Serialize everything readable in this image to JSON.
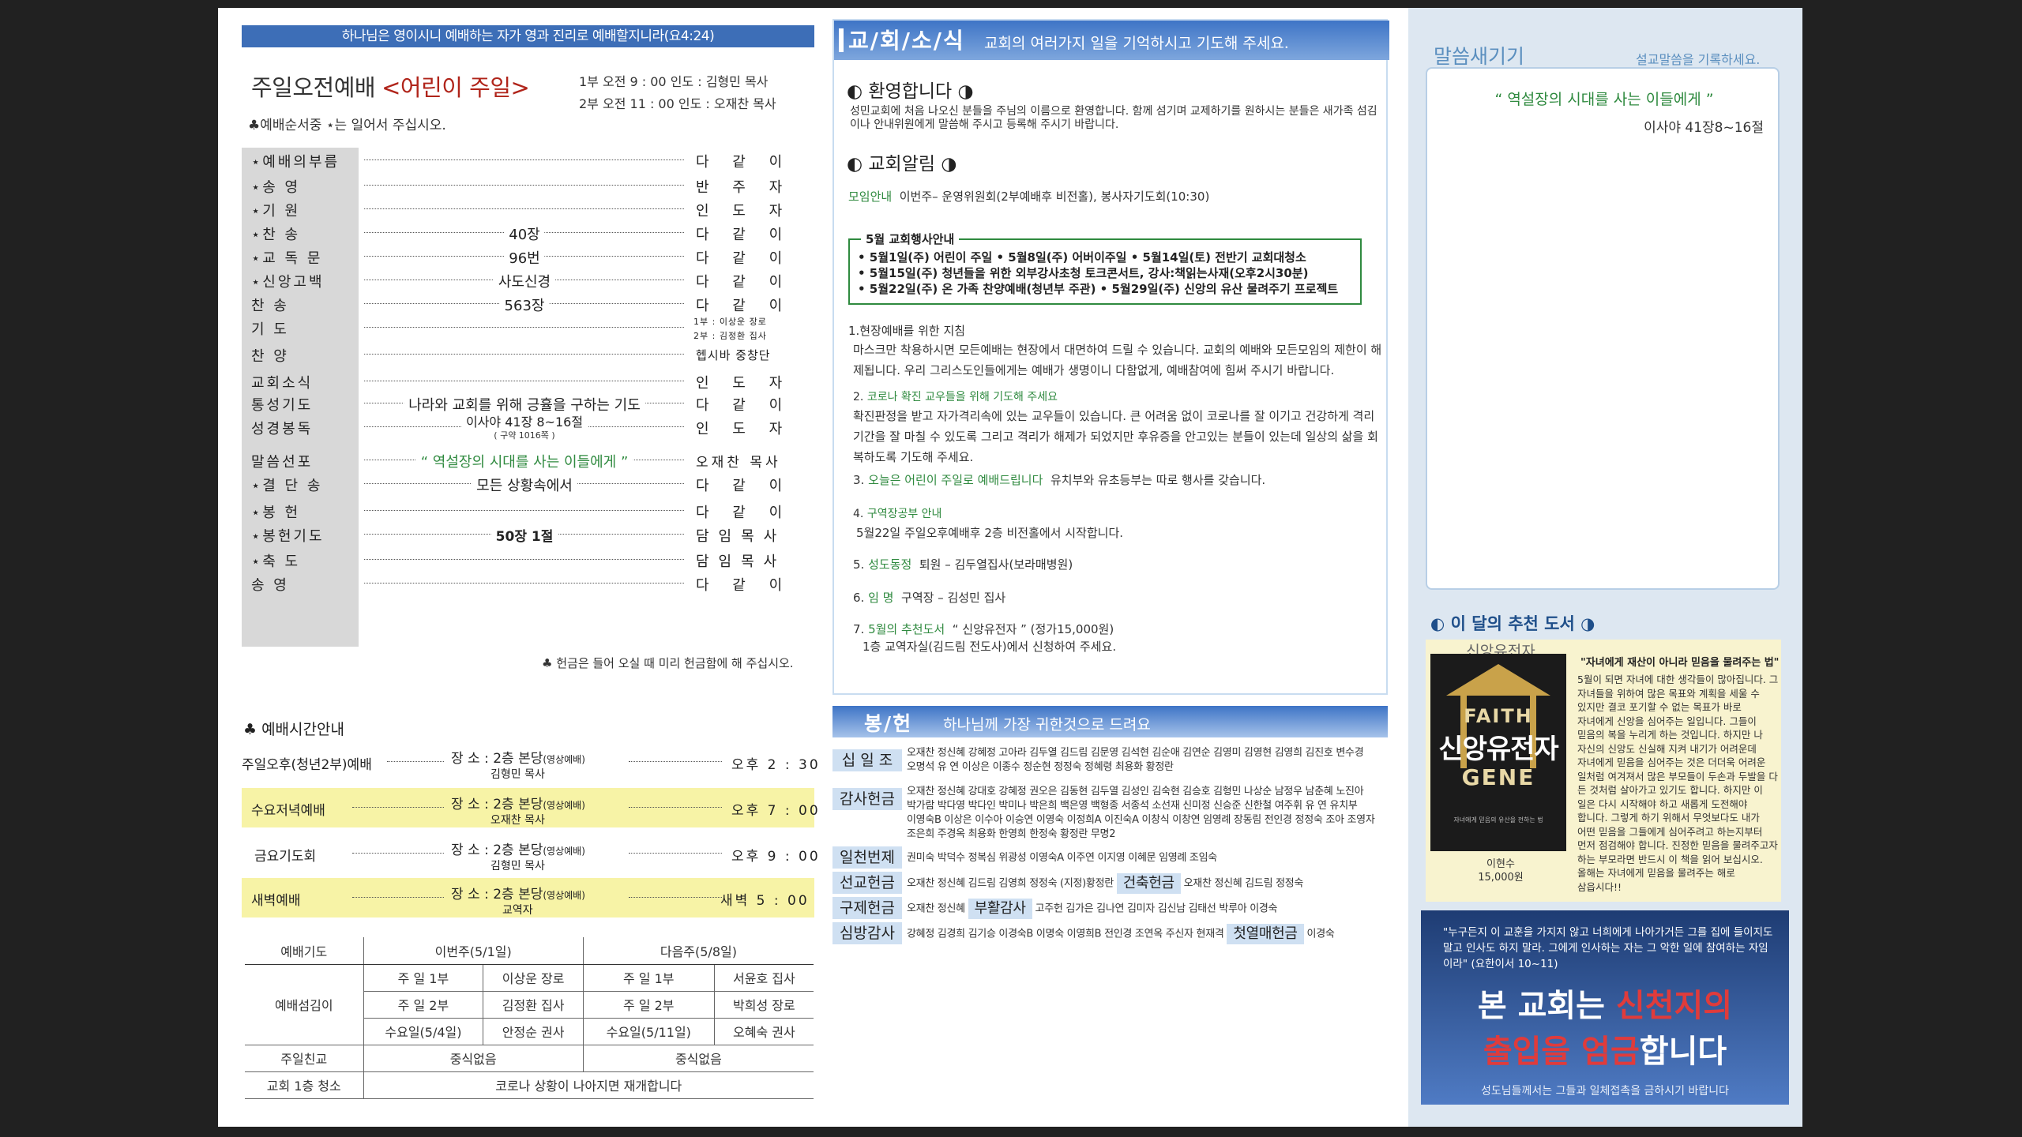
{
  "header_verse": "하나님은 영이시니 예배하는 자가 영과 진리로 예배할지니라(요4:24)",
  "service": {
    "title": "주일오전예배",
    "child": "<어린이 주일>",
    "time1": "1부 오전 9 : 00  인도 : 김형민 목사",
    "time2": "2부 오전 11 : 00  인도 : 오재찬 목사",
    "order_note": "♣예배순서중 ⋆는 일어서 주십시오."
  },
  "order": [
    {
      "label": "⋆예배의부름",
      "mid": "",
      "who": "다 같 이"
    },
    {
      "label": "⋆송    영",
      "mid": "",
      "who": "반 주 자"
    },
    {
      "label": "⋆기    원",
      "mid": "",
      "who": "인 도 자"
    },
    {
      "label": "⋆찬    송",
      "mid": "40장",
      "who": "다 같 이"
    },
    {
      "label": "⋆교 독 문",
      "mid": "96번",
      "who": "다 같 이"
    },
    {
      "label": "⋆신앙고백",
      "mid": "사도신경",
      "who": "다 같 이"
    },
    {
      "label": "찬    송",
      "mid": "563장",
      "who": "다 같 이"
    },
    {
      "label": "기    도",
      "mid": "",
      "who1": "1부 : 이상운 장로",
      "who2": "2부 : 김정환 집사"
    },
    {
      "label": "찬    양",
      "mid": "",
      "who": "헵시바 중창단"
    },
    {
      "label": "교회소식",
      "mid": "",
      "who": "인 도 자"
    },
    {
      "label": "통성기도",
      "mid": "나라와 교회를 위해 긍휼을 구하는 기도",
      "who": "다 같 이"
    },
    {
      "label": "성경봉독",
      "mid": "이사야 41장 8~16절",
      "sub": "( 구약 1016쪽 )",
      "who": "인 도 자"
    },
    {
      "label": "말씀선포",
      "mid": "“ 역설장의 시대를 사는 이들에게 ”",
      "who": "오재찬 목사"
    },
    {
      "label": "⋆결 단 송",
      "mid": "모든 상황속에서",
      "who": "다 같 이"
    },
    {
      "label": "⋆봉    헌",
      "mid": "",
      "who": "다 같 이"
    },
    {
      "label": "⋆봉헌기도",
      "mid": "50장 1절",
      "who": "담임목사"
    },
    {
      "label": "⋆축    도",
      "mid": "",
      "who": "담임목사"
    },
    {
      "label": "송    영",
      "mid": "",
      "who": "다 같 이"
    }
  ],
  "offering_note": "♣ 헌금은 들어 오실 때 미리 헌금함에 해 주십시오.",
  "times_head": "♣ 예배시간안내",
  "times": [
    {
      "name": "주일오후(청년2부)예배",
      "place": "장 소 : 2층 본당",
      "small": "(영상예배)",
      "pastor": "김형민 목사",
      "time": "오후 2 : 30"
    },
    {
      "name": "수요저녁예배",
      "place": "장 소 : 2층 본당",
      "small": "(영상예배)",
      "pastor": "오재찬 목사",
      "time": "오후 7 : 00"
    },
    {
      "name": "금요기도회",
      "place": "장 소 : 2층 본당",
      "small": "(영상예배)",
      "pastor": "김형민 목사",
      "time": "오후 9 : 00"
    },
    {
      "name": "새벽예배",
      "place": "장 소 : 2층 본당",
      "small": "(영상예배)",
      "pastor": "교역자",
      "time": "새벽 5 : 00"
    }
  ],
  "duty": {
    "head": [
      "예배기도",
      "이번주(5/1일)",
      "다음주(5/8일)"
    ],
    "label_serve": "예배섬김이",
    "rows": [
      [
        "주 일 1부",
        "이상운 장로",
        "주 일 1부",
        "서윤호 집사"
      ],
      [
        "주 일 2부",
        "김정환 집사",
        "주 일 2부",
        "박희성 장로"
      ],
      [
        "수요일(5/4일)",
        "안정순 권사",
        "수요일(5/11일)",
        "오혜숙 권사"
      ]
    ],
    "fellowship_label": "주일친교",
    "fellowship_this": "중식없음",
    "fellowship_next": "중식없음",
    "clean_label": "교회 1층 청소",
    "clean_value": "코로나 상황이 나아지면 재개합니다"
  },
  "news": {
    "head_big": "교/회/소/식",
    "head_small": "교회의 여러가지 일을 기억하시고 기도해 주세요.",
    "welcome_title": "◐ 환영합니다 ◑",
    "welcome_text": "성민교회에 처음 나오신 분들을 주님의 이름으로 환영합니다. 함께 섬기며 교제하기를 원하시는 분들은 새가족 섬김이나 안내위원에게 말씀해 주시고 등록해 주시기 바랍니다.",
    "notice_title": "◐ 교회알림 ◑",
    "meet_head": "모임안내",
    "meet_text": "이번주– 운영위원회(2부예배후 비전홀), 봉사자기도회(10:30)",
    "event_title": "5월 교회행사안내",
    "event_lines": [
      "• 5월1일(주) 어린이 주일  • 5월8일(주) 어버이주일   • 5월14일(토) 전반기 교회대청소",
      "• 5월15일(주) 청년들을 위한 외부강사초청 토크콘서트, 강사:책읽는사재(오후2시30분)",
      "• 5월22일(주) 온 가족 찬양예배(청년부 주관)   • 5월29일(주) 신앙의 유산 물려주기 프로젝트"
    ],
    "n1_head": "1.현장예배를 위한 지침",
    "n1_text": "마스크만 착용하시면 모든예배는 현장에서 대면하여 드릴 수 있습니다. 교회의 예배와 모든모임의 제한이 해제됩니다. 우리 그리스도인들에게는 예배가 생명이니 다함없게, 예배참여에 힘써 주시기 바랍니다.",
    "n2_num": "2.",
    "n2_head": "코로나 확진 교우들을 위해 기도해 주세요",
    "n2_text": "확진판정을 받고 자가격리속에 있는 교우들이 있습니다. 큰 어려움 없이 코로나를 잘 이기고 건강하게 격리기간을 잘 마칠 수 있도록  그리고 격리가 해제가 되었지만 후유증을 안고있는 분들이 있는데 일상의 삶을 회복하도록 기도해 주세요.",
    "n3_num": "3.",
    "n3_head": "오늘은 어린이 주일로 예배드립니다",
    "n3_text": "유치부와 유초등부는 따로 행사를 갖습니다.",
    "n4_num": "4.",
    "n4_head": "구역장공부 안내",
    "n4_text": "5월22일 주일오후예배후 2층 비전홀에서 시작합니다.",
    "n5_num": "5.",
    "n5_head": "성도동정",
    "n5_text": "퇴원 – 김두열집사(보라매병원)",
    "n6_num": "6.",
    "n6_head": "임 명",
    "n6_text": "구역장 – 김성민 집사",
    "n7_num": "7.",
    "n7_head": "5월의 추천도서",
    "n7_text": "“ 신앙유전자 ” (정가15,000원)",
    "n7_text2": "1층 교역자실(김드림 전도사)에서 신청하여 주세요."
  },
  "offer": {
    "head_big": "봉/헌",
    "head_small": "하나님께 가장 귀한것으로 드려요",
    "tithe_label": "십 일 조",
    "tithe_names": "오재찬 정신혜 강혜정 고아라 김두열 김드림 김문영 김석현 김순애 김연순 김영미 김영현 김영희 김진호 변수경 오명석 유  연 이상은 이종수 정순현 정정숙 정혜령 최용화 황정란",
    "thanks_label": "감사헌금",
    "thanks_names": "오재찬 정신혜 강대호 강혜정 권오은 김동현 김두열 김성인 김숙현 김승호 김형민 나상순 남정우 남춘혜 노진아 박가람 박다영 박다인 박미나 박은희 백은영 백형종 서종석 소선재 신미정 신승준 신한철 여주휘 유  연 유치부 이영숙B 이상은 이수아 이승연 이영숙 이정희A 이진숙A 이창식 이창연 임영례 장동림 전인경 정정숙 조아 조영자 조은희 주경옥 최용화 한영희 한정숙 황정란 무명2",
    "mission_label": "일천번제",
    "mission_names": "권미숙 박덕수 정복심 위광성 이영숙A 이주연 이지영 이혜문 임영례 조임숙",
    "mission2_label": "선교헌금",
    "mission2_names": "오재찬 정신혜 김드림 김영희 정정숙 (지정)황정란",
    "build_label": "건축헌금",
    "build_names": "오재찬 정신혜 김드림 정정숙",
    "relief_label": "구제헌금",
    "relief_names": "오재찬 정신혜",
    "easter_label": "부활감사",
    "easter_names": "고주헌 김가은 김나연 김미자 김신남 김태선 박루아 이경숙",
    "heart_label": "심방감사",
    "heart_names": "강혜정 김경희 김기승 이경숙B 이명숙 이영희B 전인경 조연옥 주신자 현재격",
    "first_label": "첫열매헌금",
    "first_names": "이경숙"
  },
  "memo": {
    "title": "말씀새기기",
    "sub": "설교말씀을 기록하세요.",
    "quote": "“ 역설장의 시대를 사는 이들에게 ”",
    "ref": "이사야 41장8~16절"
  },
  "book": {
    "head": "◐ 이 달의 추천 도서 ◑",
    "name": "신앙유전자",
    "cover_faith": "FAITH",
    "cover_kr": "신앙유전자",
    "cover_gene": "GENE",
    "cover_tag": "자녀에게 믿음의 유산을 전하는 법",
    "author": "이현수",
    "price": "15,000원",
    "quote": "\"자녀에게 재산이 아니라 믿음을 물려주는 법\"",
    "desc": "5월이 되면 자녀에 대한 생각들이 많아집니다. 그 자녀들을 위하여 많은 목표와 계획을 세울 수 있지만 결코 포기할 수 없는 목표가 바로 자녀에게 신앙을 심어주는 일입니다. 그들이 믿음의 복을 누리게 하는 것입니다. 하지만 나 자신의 신앙도 신실해 지켜 내기가 어려운데 자녀에게 믿음을 심어주는 것은 더더욱 어려운 일처럼 여겨져서 많은 부모들이 두손과 두발을 다 든 것처럼 살아가고 있기도 합니다. 하지만 이 일은 다시 시작해야 하고 새롭게 도전해야 합니다. 그렇게 하기 위해서 무엇보다도 내가 어떤 믿음을 그들에게 심어주려고 하는지부터 먼저 점검해야 합니다. 진정한 믿음을 물려주고자 하는 부모라면 반드시 이 책을 읽어 보십시오. 올해는 자녀에게 믿음을 물려주는 해로 삼읍시다!!"
  },
  "warn": {
    "quote": "\"누구든지 이 교훈을 가지지 않고 너희에게 나아가거든 그를 집에 들이지도 말고 인사도 하지 말라. 그에게 인사하는 자는 그 악한 일에 참여하는 자임이라\" (요한이서 10~11)",
    "l1a": "본 교회는 ",
    "l1b": "신천지의",
    "l2a": "출입을 엄금",
    "l2b": "합니다",
    "foot": "성도님들께서는 그들과 일체접촉을 금하시기 바랍니다"
  }
}
